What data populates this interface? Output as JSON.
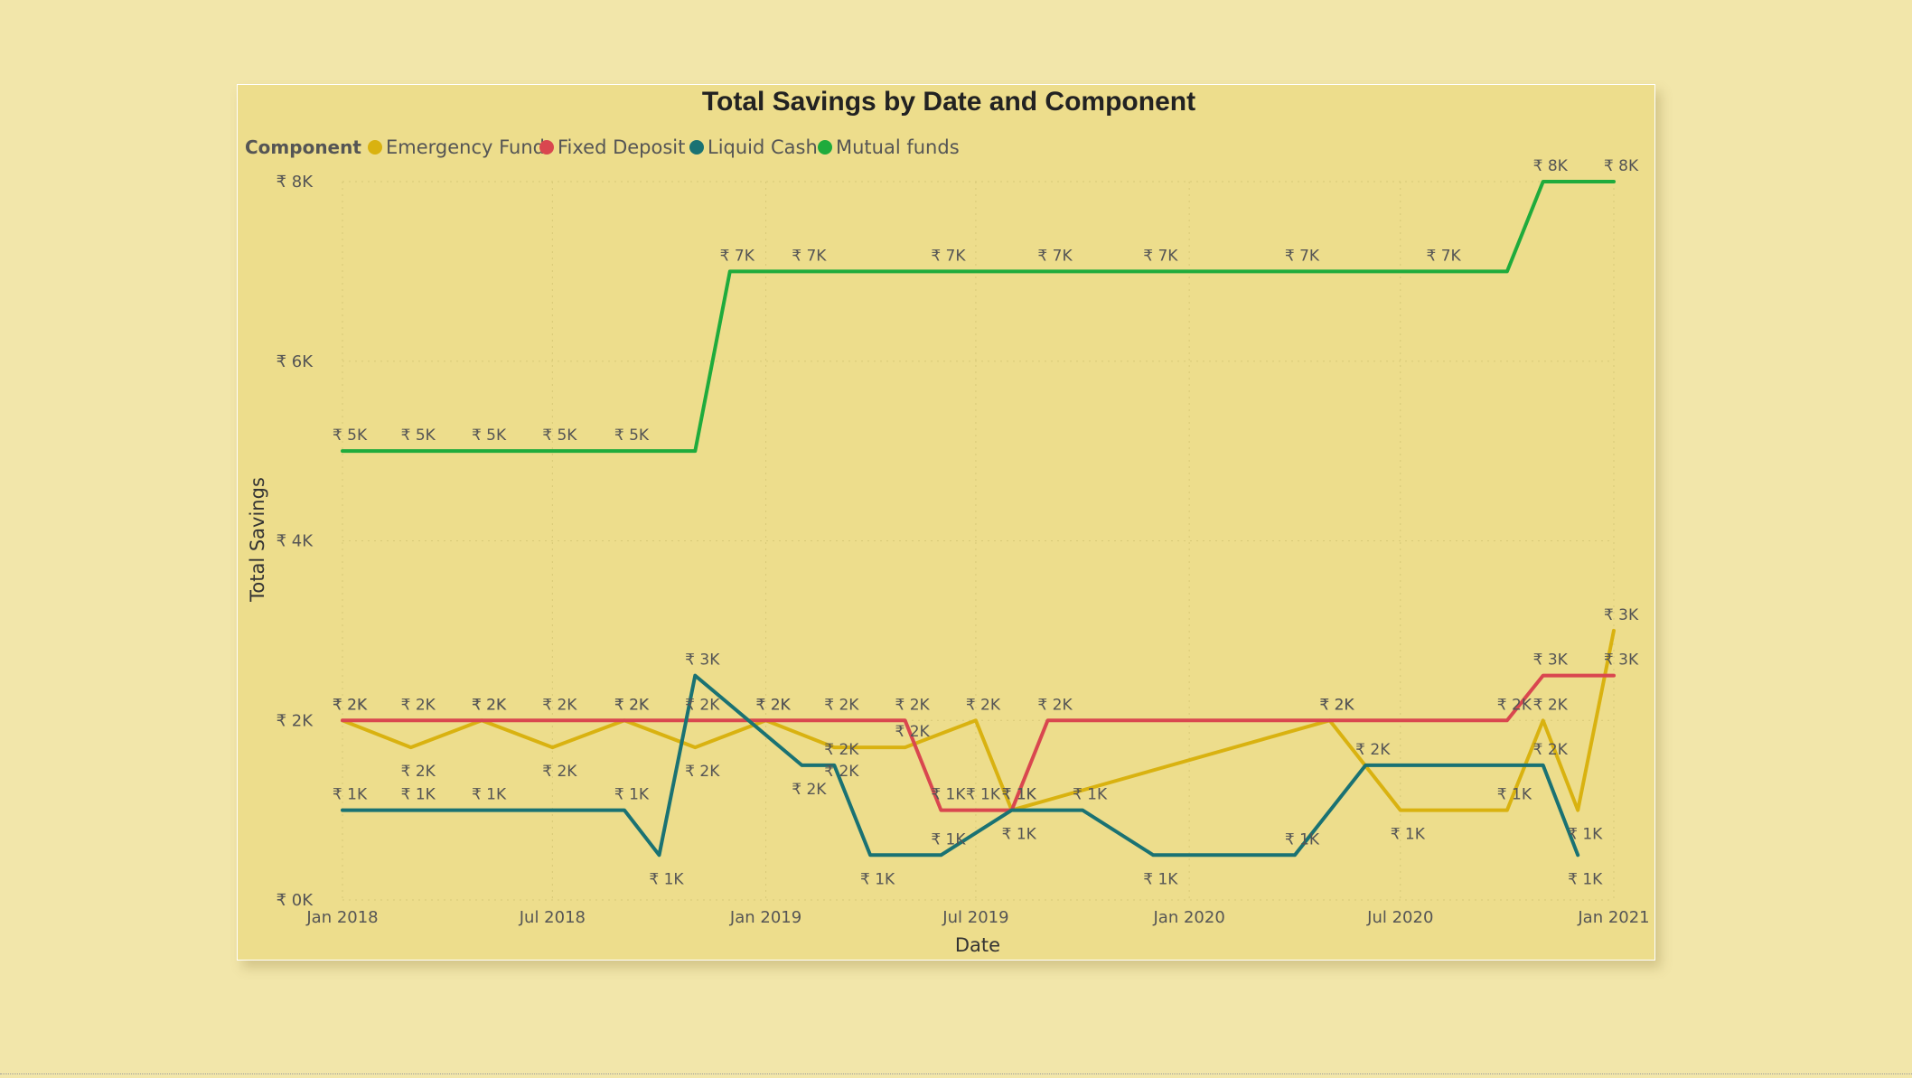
{
  "chart_data": {
    "type": "line",
    "title": "Total Savings by Date and Component",
    "legend_title": "Component",
    "legend_position": "top-left",
    "xlabel": "Date",
    "ylabel": "Total Savings",
    "x_ticks": [
      "Jan 2018",
      "Jul 2018",
      "Jan 2019",
      "Jul 2019",
      "Jan 2020",
      "Jul 2020",
      "Jan 2021"
    ],
    "y_ticks": [
      "₹ 0K",
      "₹ 2K",
      "₹ 4K",
      "₹ 6K",
      "₹ 8K"
    ],
    "ylim": [
      0,
      8000
    ],
    "xlim": [
      "2018-01-01",
      "2021-01-01"
    ],
    "grid": true,
    "series": [
      {
        "name": "Emergency Fund",
        "color": "#d9b210",
        "x": [
          "2018-01-01",
          "2018-03-01",
          "2018-05-01",
          "2018-07-01",
          "2018-09-01",
          "2018-11-01",
          "2019-01-01",
          "2019-03-01",
          "2019-05-01",
          "2019-07-01",
          "2019-08-01",
          "2020-05-01",
          "2020-07-01",
          "2020-10-01",
          "2020-11-01",
          "2020-12-01",
          "2021-01-01"
        ],
        "values": [
          2000,
          1700,
          2000,
          1700,
          2000,
          1700,
          2000,
          1700,
          1700,
          2000,
          1000,
          2000,
          1000,
          1000,
          2000,
          1000,
          3000
        ],
        "labels": [
          "₹ 2K",
          "₹ 2K",
          "₹ 2K",
          "₹ 2K",
          "₹ 2K",
          "₹ 2K",
          "₹ 2K",
          "₹ 2K",
          "₹ 2K",
          "₹ 2K",
          "₹ 1K",
          "₹ 2K",
          "₹ 1K",
          "₹ 1K",
          "₹ 2K",
          "₹ 1K",
          "₹ 3K"
        ]
      },
      {
        "name": "Fixed Deposit",
        "color": "#d9474f",
        "x": [
          "2018-01-01",
          "2018-03-01",
          "2018-05-01",
          "2018-07-01",
          "2018-09-01",
          "2018-11-01",
          "2019-01-01",
          "2019-03-01",
          "2019-05-01",
          "2019-06-01",
          "2019-07-01",
          "2019-08-01",
          "2019-09-01",
          "2020-05-01",
          "2020-10-01",
          "2020-11-01",
          "2021-01-01"
        ],
        "values": [
          2000,
          2000,
          2000,
          2000,
          2000,
          2000,
          2000,
          2000,
          2000,
          1000,
          1000,
          1000,
          2000,
          2000,
          2000,
          2500,
          2500
        ],
        "labels": [
          "₹ 2K",
          "₹ 2K",
          "₹ 2K",
          "₹ 2K",
          "₹ 2K",
          "₹ 2K",
          "₹ 2K",
          "₹ 2K",
          "₹ 2K",
          "₹ 1K",
          "₹ 1K",
          "₹ 1K",
          "₹ 2K",
          "₹ 2K",
          "₹ 2K",
          "₹ 3K",
          "₹ 3K"
        ]
      },
      {
        "name": "Liquid Cash",
        "color": "#1a7273",
        "x": [
          "2018-01-01",
          "2018-03-01",
          "2018-05-01",
          "2018-09-01",
          "2018-10-01",
          "2018-11-01",
          "2019-02-01",
          "2019-03-01",
          "2019-04-01",
          "2019-06-01",
          "2019-08-01",
          "2019-10-01",
          "2019-12-01",
          "2020-04-01",
          "2020-06-01",
          "2020-11-01",
          "2020-12-01"
        ],
        "values": [
          1000,
          1000,
          1000,
          1000,
          500,
          2500,
          1500,
          1500,
          500,
          500,
          1000,
          1000,
          500,
          500,
          1500,
          1500,
          500
        ],
        "labels": [
          "₹ 1K",
          "₹ 1K",
          "₹ 1K",
          "₹ 1K",
          "₹ 1K",
          "₹ 3K",
          "₹ 2K",
          "₹ 2K",
          "₹ 1K",
          "₹ 1K",
          "₹ 1K",
          "₹ 1K",
          "₹ 1K",
          "₹ 1K",
          "₹ 2K",
          "₹ 2K",
          "₹ 1K"
        ]
      },
      {
        "name": "Mutual funds",
        "color": "#1fab3c",
        "x": [
          "2018-01-01",
          "2018-03-01",
          "2018-05-01",
          "2018-07-01",
          "2018-09-01",
          "2018-11-01",
          "2018-12-01",
          "2019-02-01",
          "2019-06-01",
          "2019-09-01",
          "2019-12-01",
          "2020-04-01",
          "2020-08-01",
          "2020-10-01",
          "2020-11-01",
          "2021-01-01"
        ],
        "values": [
          5000,
          5000,
          5000,
          5000,
          5000,
          5000,
          7000,
          7000,
          7000,
          7000,
          7000,
          7000,
          7000,
          7000,
          8000,
          8000
        ],
        "labels": [
          "₹ 5K",
          "₹ 5K",
          "₹ 5K",
          "₹ 5K",
          "₹ 5K",
          "",
          "₹ 7K",
          "₹ 7K",
          "₹ 7K",
          "₹ 7K",
          "₹ 7K",
          "₹ 7K",
          "₹ 7K",
          "",
          "₹ 8K",
          "₹ 8K"
        ]
      }
    ]
  }
}
